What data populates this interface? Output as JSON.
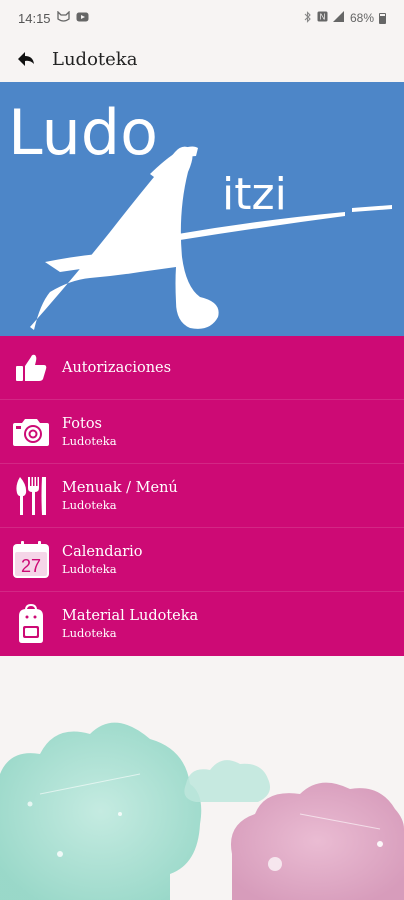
{
  "status_bar": {
    "time": "14:15",
    "battery": "68%",
    "icons": [
      "cat-icon",
      "youtube-icon",
      "bluetooth-icon",
      "nfc-icon",
      "signal-icon",
      "battery-icon"
    ]
  },
  "app_bar": {
    "title": "Ludoteka",
    "back_icon": "back-arrow-icon"
  },
  "hero": {
    "logo_line1": "Ludo",
    "logo_line2": "itzi",
    "background_color": "#4d86c8"
  },
  "menu": {
    "background_color": "#cd0a75",
    "items": [
      {
        "title": "Autorizaciones",
        "subtitle": "",
        "icon": "thumbs-up-icon"
      },
      {
        "title": "Fotos",
        "subtitle": "Ludoteka",
        "icon": "camera-icon"
      },
      {
        "title": "Menuak / Menú",
        "subtitle": "Ludoteka",
        "icon": "cutlery-icon"
      },
      {
        "title": "Calendario",
        "subtitle": "Ludoteka",
        "icon": "calendar-icon",
        "icon_text": "27"
      },
      {
        "title": "Material Ludoteka",
        "subtitle": "Ludoteka",
        "icon": "backpack-icon"
      }
    ]
  }
}
